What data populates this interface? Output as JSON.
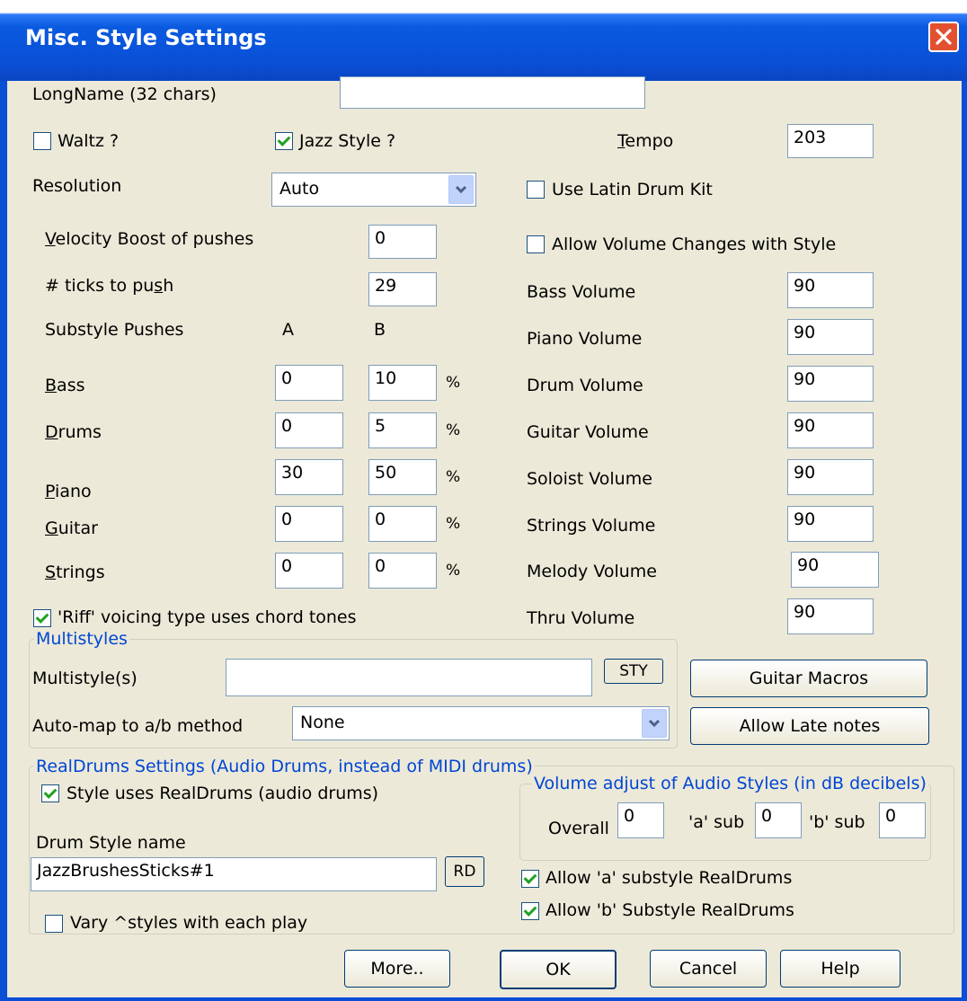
{
  "window": {
    "title": "Misc. Style Settings"
  },
  "longname": {
    "label": "LongName (32 chars)",
    "value": ""
  },
  "waltz": {
    "label": "Waltz ?",
    "checked": false
  },
  "jazz_style": {
    "label": "Jazz Style ?",
    "checked": true
  },
  "tempo": {
    "label_first": "T",
    "label_rest": "empo",
    "value": "203"
  },
  "resolution": {
    "label": "Resolution",
    "value": "Auto"
  },
  "latin_drum": {
    "label": "Use Latin Drum Kit",
    "checked": false
  },
  "velocity_boost": {
    "label_first": "V",
    "label_rest": "elocity Boost of pushes",
    "value": "0"
  },
  "allow_volume": {
    "label": "Allow Volume Changes with Style",
    "checked": false
  },
  "ticks_push": {
    "label_pre": "# ticks to pu",
    "label_u": "s",
    "label_post": "h",
    "value": "29"
  },
  "substyle_pushes": {
    "label": "Substyle Pushes",
    "col_a": "A",
    "col_b": "B"
  },
  "pushes": [
    {
      "first": "B",
      "rest": "ass",
      "a": "0",
      "b": "10",
      "unit": "%"
    },
    {
      "first": "D",
      "rest": "rums",
      "a": "0",
      "b": "5",
      "unit": "%"
    },
    {
      "first": "P",
      "rest": "iano",
      "a": "30",
      "b": "50",
      "unit": "%"
    },
    {
      "first": "G",
      "rest": "uitar",
      "a": "0",
      "b": "0",
      "unit": "%"
    },
    {
      "first": "S",
      "rest": "trings",
      "a": "0",
      "b": "0",
      "unit": "%"
    }
  ],
  "volumes": [
    {
      "label": "Bass Volume",
      "value": "90"
    },
    {
      "label": "Piano Volume",
      "value": "90"
    },
    {
      "label": "Drum Volume",
      "value": "90"
    },
    {
      "label": "Guitar Volume",
      "value": "90"
    },
    {
      "label": "Soloist Volume",
      "value": "90"
    },
    {
      "label": "Strings Volume",
      "value": "90"
    },
    {
      "label": "Melody Volume",
      "value": "90"
    },
    {
      "label": "Thru Volume",
      "value": "90"
    }
  ],
  "riff_voicing": {
    "label": "'Riff' voicing type uses chord tones",
    "checked": true
  },
  "multistyles": {
    "group_label": "Multistyles",
    "multistyle_label": "Multistyle(s)",
    "multistyle_value": "",
    "sty_button": "STY",
    "automap_label": "Auto-map to a/b method",
    "automap_value": "None"
  },
  "guitar_macros_button": "Guitar Macros",
  "allow_late_notes_button": "Allow Late notes",
  "realdrums": {
    "group_label": "RealDrums Settings (Audio Drums, instead of MIDI drums)",
    "uses_realdrums": {
      "label": "Style uses RealDrums (audio drums)",
      "checked": true
    },
    "drum_style_label": "Drum Style name",
    "drum_style_value": "JazzBrushesSticks#1",
    "rd_button": "RD",
    "vary_styles": {
      "label": "Vary ^styles with each play",
      "checked": false
    },
    "volume_group_label": "Volume adjust of Audio Styles (in dB decibels)",
    "overall_label": "Overall",
    "overall_value": "0",
    "a_sub_label": "'a' sub",
    "a_sub_value": "0",
    "b_sub_label": "'b' sub",
    "b_sub_value": "0",
    "allow_a": {
      "label": "Allow 'a' substyle RealDrums",
      "checked": true
    },
    "allow_b": {
      "label": "Allow 'b' Substyle RealDrums",
      "checked": true
    }
  },
  "buttons": {
    "more": "More..",
    "ok": "OK",
    "cancel": "Cancel",
    "help": "Help"
  },
  "colors": {
    "titlebar": "#0a4fd6",
    "dialog_bg": "#ece9d8",
    "group_label": "#0046d5",
    "close": "#e2502f",
    "check": "#21a121"
  }
}
